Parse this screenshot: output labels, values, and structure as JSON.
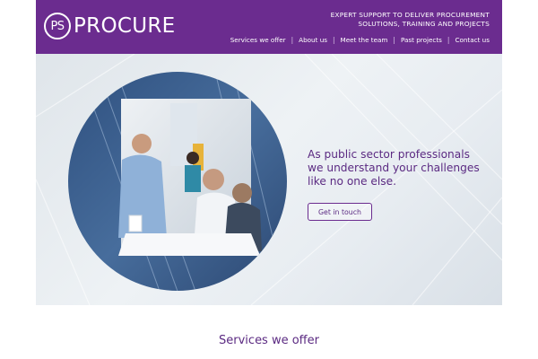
{
  "brand": {
    "logo_mark": "PS",
    "logo_word": "PROCURE",
    "purple": "#6b2c8f"
  },
  "header": {
    "tagline_line1": "EXPERT SUPPORT TO DELIVER PROCUREMENT",
    "tagline_line2": "SOLUTIONS, TRAINING AND PROJECTS"
  },
  "nav": {
    "items": [
      {
        "label": "Services we offer"
      },
      {
        "label": "About us"
      },
      {
        "label": "Meet the team"
      },
      {
        "label": "Past projects"
      },
      {
        "label": "Contact us"
      }
    ],
    "separator": "|"
  },
  "hero": {
    "line1": "As public sector professionals",
    "line2": "we understand your challenges",
    "line3": "like no one else.",
    "cta_label": "Get in touch"
  },
  "section": {
    "title": "Services we offer"
  }
}
